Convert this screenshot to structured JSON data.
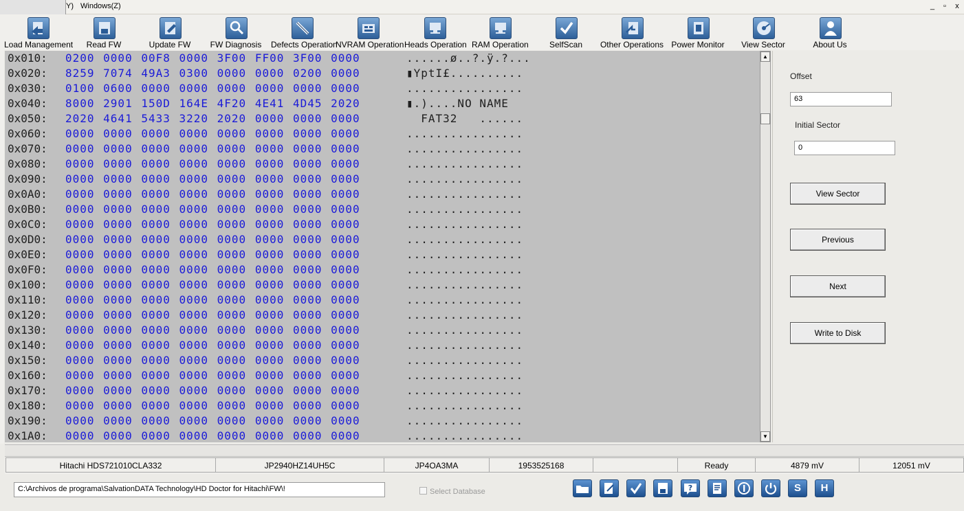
{
  "menubar": {
    "fragment": "Y)",
    "windows": "Windows(Z)",
    "controls": [
      "_",
      "▫",
      "x"
    ]
  },
  "toolbar": [
    {
      "label": "Load Management",
      "icon": "load-management-icon"
    },
    {
      "label": "Read FW",
      "icon": "read-fw-icon"
    },
    {
      "label": "Update FW",
      "icon": "update-fw-icon"
    },
    {
      "label": "FW Diagnosis",
      "icon": "fw-diagnosis-icon"
    },
    {
      "label": "Defects Operation",
      "icon": "defects-operation-icon"
    },
    {
      "label": "NVRAM Operation",
      "icon": "nvram-operation-icon"
    },
    {
      "label": "Heads Operation",
      "icon": "heads-operation-icon"
    },
    {
      "label": "RAM Operation",
      "icon": "ram-operation-icon"
    },
    {
      "label": "SelfScan",
      "icon": "selfscan-icon"
    },
    {
      "label": "Other Operations",
      "icon": "other-operations-icon"
    },
    {
      "label": "Power Monitor",
      "icon": "power-monitor-icon"
    },
    {
      "label": "View Sector",
      "icon": "view-sector-icon"
    },
    {
      "label": "About Us",
      "icon": "about-us-icon"
    }
  ],
  "hex": {
    "rows": [
      {
        "addr": "0x010:",
        "bytes": "0200 0000 00F8 0000 3F00 FF00 3F00 0000",
        "ascii": "......ø..?.ÿ.?..."
      },
      {
        "addr": "0x020:",
        "bytes": "8259 7074 49A3 0300 0000 0000 0200 0000",
        "ascii": "▮YptI£.........."
      },
      {
        "addr": "0x030:",
        "bytes": "0100 0600 0000 0000 0000 0000 0000 0000",
        "ascii": "................"
      },
      {
        "addr": "0x040:",
        "bytes": "8000 2901 150D 164E 4F20 4E41 4D45 2020",
        "ascii": "▮.)....NO NAME  "
      },
      {
        "addr": "0x050:",
        "bytes": "2020 4641 5433 3220 2020 0000 0000 0000",
        "ascii": "  FAT32   ......"
      },
      {
        "addr": "0x060:",
        "bytes": "0000 0000 0000 0000 0000 0000 0000 0000",
        "ascii": "................"
      },
      {
        "addr": "0x070:",
        "bytes": "0000 0000 0000 0000 0000 0000 0000 0000",
        "ascii": "................"
      },
      {
        "addr": "0x080:",
        "bytes": "0000 0000 0000 0000 0000 0000 0000 0000",
        "ascii": "................"
      },
      {
        "addr": "0x090:",
        "bytes": "0000 0000 0000 0000 0000 0000 0000 0000",
        "ascii": "................"
      },
      {
        "addr": "0x0A0:",
        "bytes": "0000 0000 0000 0000 0000 0000 0000 0000",
        "ascii": "................"
      },
      {
        "addr": "0x0B0:",
        "bytes": "0000 0000 0000 0000 0000 0000 0000 0000",
        "ascii": "................"
      },
      {
        "addr": "0x0C0:",
        "bytes": "0000 0000 0000 0000 0000 0000 0000 0000",
        "ascii": "................"
      },
      {
        "addr": "0x0D0:",
        "bytes": "0000 0000 0000 0000 0000 0000 0000 0000",
        "ascii": "................"
      },
      {
        "addr": "0x0E0:",
        "bytes": "0000 0000 0000 0000 0000 0000 0000 0000",
        "ascii": "................"
      },
      {
        "addr": "0x0F0:",
        "bytes": "0000 0000 0000 0000 0000 0000 0000 0000",
        "ascii": "................"
      },
      {
        "addr": "0x100:",
        "bytes": "0000 0000 0000 0000 0000 0000 0000 0000",
        "ascii": "................"
      },
      {
        "addr": "0x110:",
        "bytes": "0000 0000 0000 0000 0000 0000 0000 0000",
        "ascii": "................"
      },
      {
        "addr": "0x120:",
        "bytes": "0000 0000 0000 0000 0000 0000 0000 0000",
        "ascii": "................"
      },
      {
        "addr": "0x130:",
        "bytes": "0000 0000 0000 0000 0000 0000 0000 0000",
        "ascii": "................"
      },
      {
        "addr": "0x140:",
        "bytes": "0000 0000 0000 0000 0000 0000 0000 0000",
        "ascii": "................"
      },
      {
        "addr": "0x150:",
        "bytes": "0000 0000 0000 0000 0000 0000 0000 0000",
        "ascii": "................"
      },
      {
        "addr": "0x160:",
        "bytes": "0000 0000 0000 0000 0000 0000 0000 0000",
        "ascii": "................"
      },
      {
        "addr": "0x170:",
        "bytes": "0000 0000 0000 0000 0000 0000 0000 0000",
        "ascii": "................"
      },
      {
        "addr": "0x180:",
        "bytes": "0000 0000 0000 0000 0000 0000 0000 0000",
        "ascii": "................"
      },
      {
        "addr": "0x190:",
        "bytes": "0000 0000 0000 0000 0000 0000 0000 0000",
        "ascii": "................"
      },
      {
        "addr": "0x1A0:",
        "bytes": "0000 0000 0000 0000 0000 0000 0000 0000",
        "ascii": "................"
      }
    ]
  },
  "sector_panel": {
    "offset_label": "Offset",
    "offset_value": "63",
    "initial_sector_label": "Initial Sector",
    "initial_sector_value": "0",
    "view_sector_button": "View Sector",
    "previous_button": "Previous",
    "next_button": "Next",
    "write_to_disk_button": "Write to Disk"
  },
  "status": {
    "model": "Hitachi HDS721010CLA332",
    "serial": "JP2940HZ14UH5C",
    "firmware": "JP4OA3MA",
    "lba": "1953525168",
    "empty": "",
    "state": "Ready",
    "voltage_5v": "4879 mV",
    "voltage_12v": "12051 mV"
  },
  "bottom": {
    "path": "C:\\Archivos de programa\\SalvationDATA Technology\\HD Doctor for Hitachi\\FW\\!",
    "select_database": "Select Database",
    "icons": [
      "open-folder-icon",
      "edit-icon",
      "check-icon",
      "save-icon",
      "help-icon",
      "notes-icon",
      "info-icon",
      "power-icon",
      "s-icon",
      "h-icon"
    ],
    "s_letter": "S",
    "h_letter": "H"
  },
  "colors": {
    "hex_bytes": "#1a1ad8",
    "hex_background": "#c0c0c0",
    "icon_blue": "#2d5f99"
  }
}
